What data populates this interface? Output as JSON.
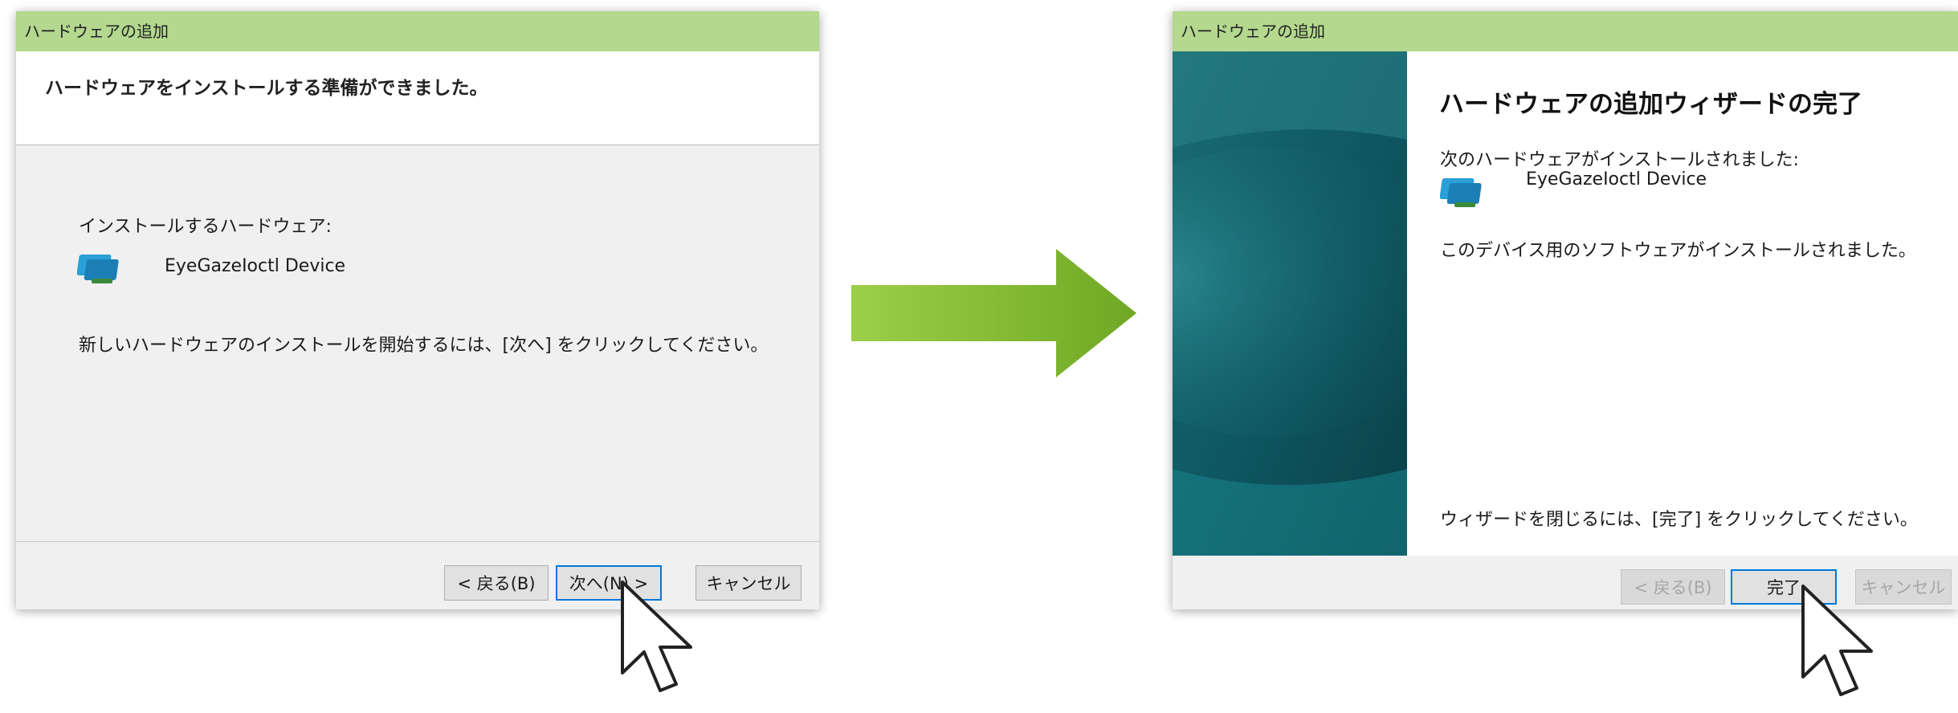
{
  "left_dialog": {
    "title": "ハードウェアの追加",
    "header_text": "ハードウェアをインストールする準備ができました。",
    "install_label": "インストールするハードウェア:",
    "device_name": "EyeGazeIoctl Device",
    "instruction": "新しいハードウェアのインストールを開始するには、[次へ] をクリックしてください。",
    "buttons": {
      "back": "< 戻る(B)",
      "next": "次へ(N) >",
      "cancel": "キャンセル"
    }
  },
  "right_dialog": {
    "title": "ハードウェアの追加",
    "heading": "ハードウェアの追加ウィザードの完了",
    "installed_label": "次のハードウェアがインストールされました:",
    "device_name": "EyeGazeIoctl Device",
    "software_msg": "このデバイス用のソフトウェアがインストールされました。",
    "close_msg": "ウィザードを閉じるには、[完了] をクリックしてください。",
    "buttons": {
      "back": "< 戻る(B)",
      "finish": "完了",
      "cancel": "キャンセル"
    }
  },
  "colors": {
    "titlebar": "#b3d88e",
    "arrow": "#7fb82c",
    "focus_border": "#0078d7",
    "side_art": "#0e5862"
  },
  "icons": [
    "device-icon",
    "mouse-cursor-icon",
    "green-arrow-icon"
  ]
}
